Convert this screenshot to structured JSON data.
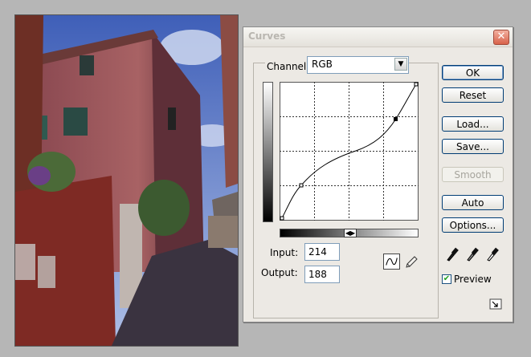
{
  "dialog": {
    "title": "Curves",
    "close_symbol": "✕",
    "channel": {
      "label": "Channel:",
      "value": "RGB"
    },
    "input": {
      "label": "Input:",
      "value": "214"
    },
    "output": {
      "label": "Output:",
      "value": "188"
    },
    "buttons": {
      "ok": "OK",
      "reset": "Reset",
      "load": "Load...",
      "save": "Save...",
      "smooth": "Smooth",
      "auto": "Auto",
      "options": "Options..."
    },
    "preview": {
      "label": "Preview",
      "checked": true
    }
  },
  "icons": [
    "close-icon",
    "chevron-down-icon",
    "curve-tool-icon",
    "pencil-icon",
    "black-eyedropper-icon",
    "gray-eyedropper-icon",
    "white-eyedropper-icon",
    "expand-icon"
  ]
}
